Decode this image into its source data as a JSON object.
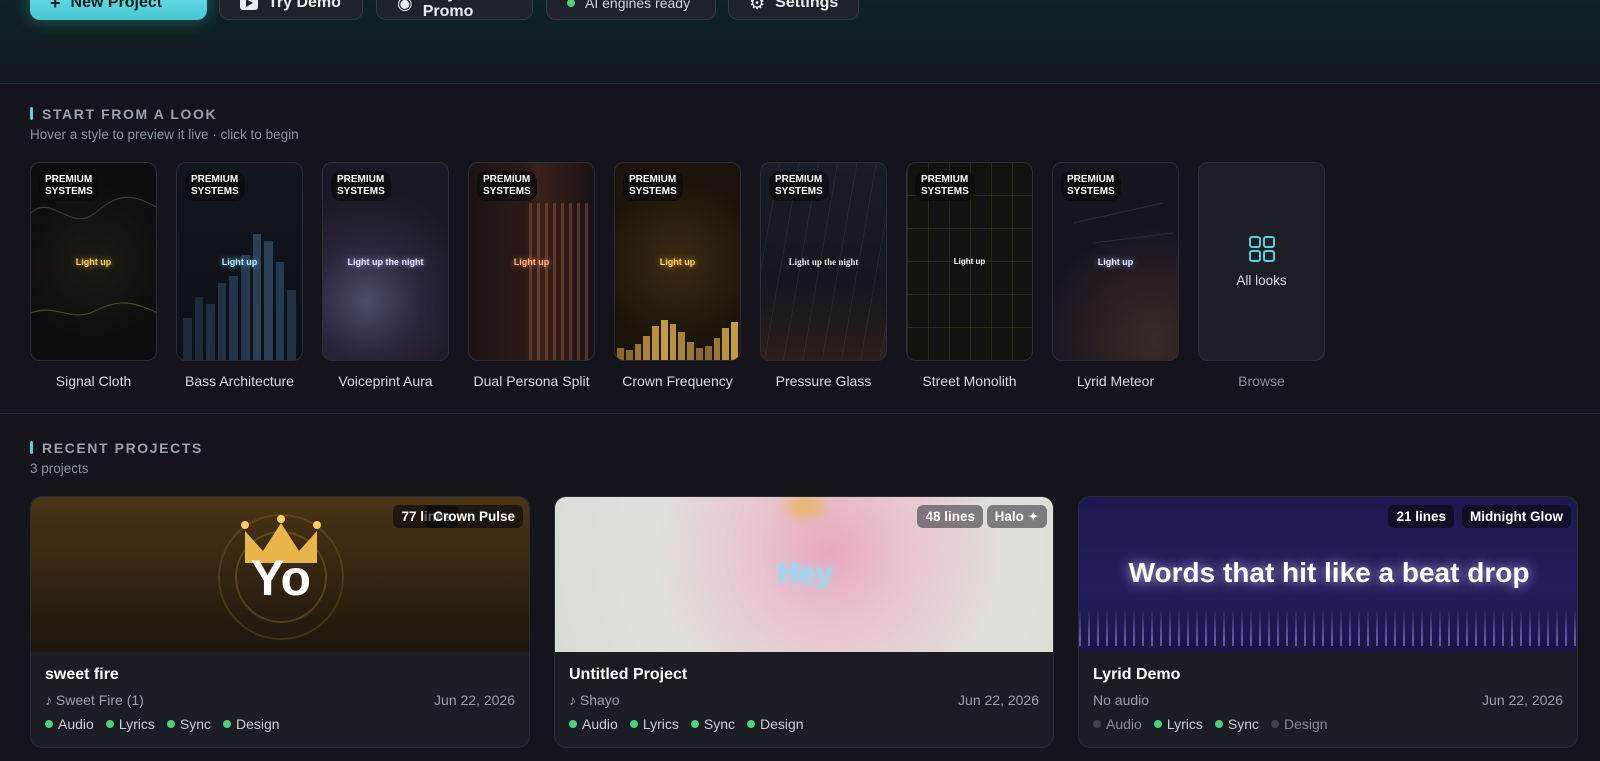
{
  "toolbar": {
    "new_project": "New Project",
    "try_demo": "Try Demo",
    "vinyl_promo": "Vinyl Promo",
    "engines_status": "AI engines ready",
    "settings": "Settings"
  },
  "looks_section": {
    "title": "START FROM A LOOK",
    "subtitle": "Hover a style to preview it live · click to begin",
    "badge": "PREMIUM SYSTEMS",
    "items": [
      {
        "name": "Signal Cloth",
        "preview": "Light up"
      },
      {
        "name": "Bass Architecture",
        "preview": "Light up"
      },
      {
        "name": "Voiceprint Aura",
        "preview": "Light up the night"
      },
      {
        "name": "Dual Persona Split",
        "preview": "Light up"
      },
      {
        "name": "Crown Frequency",
        "preview": "Light up"
      },
      {
        "name": "Pressure Glass",
        "preview": "Light up the night"
      },
      {
        "name": "Street Monolith",
        "preview": "Light up"
      },
      {
        "name": "Lyrid Meteor",
        "preview": "Light up"
      }
    ],
    "all_looks": "All looks",
    "browse": "Browse"
  },
  "projects_section": {
    "title": "RECENT PROJECTS",
    "count": "3 projects",
    "projects": [
      {
        "title": "sweet fire",
        "audio": "Sweet Fire (1)",
        "date": "Jun 22, 2026",
        "lines": "77 lines",
        "style": "Crown Pulse",
        "cover_text": "Yo",
        "steps": [
          "Audio",
          "Lyrics",
          "Sync",
          "Design"
        ]
      },
      {
        "title": "Untitled Project",
        "audio": "Shayo",
        "date": "Jun 22, 2026",
        "lines": "48 lines",
        "style": "Halo ✦",
        "cover_text": "Hey",
        "steps": [
          "Audio",
          "Lyrics",
          "Sync",
          "Design"
        ]
      },
      {
        "title": "Lyrid Demo",
        "audio": "No audio",
        "date": "Jun 22, 2026",
        "lines": "21 lines",
        "style": "Midnight Glow",
        "cover_text": "Words that hit like a beat drop",
        "steps": [
          "Audio",
          "Lyrics",
          "Sync",
          "Design"
        ]
      }
    ]
  },
  "colors": {
    "accent": "#56d0dc",
    "step_done": "#4fd17a",
    "step_pending": "#3f4249"
  }
}
